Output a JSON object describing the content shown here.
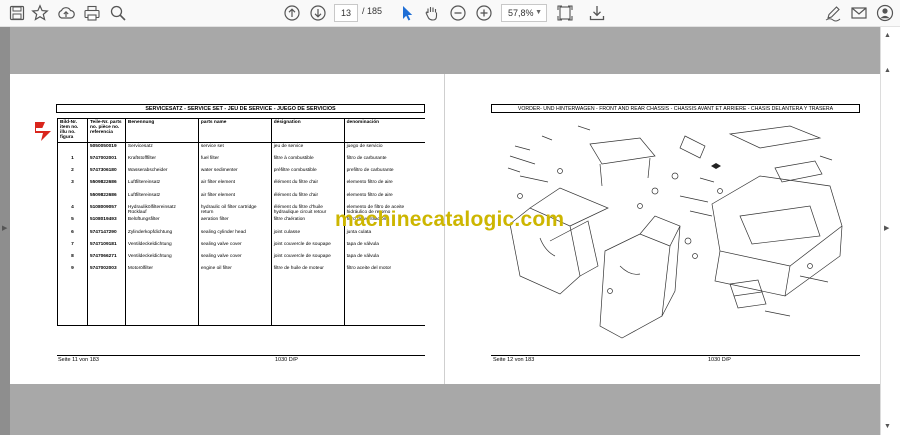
{
  "toolbar": {
    "page_current": "13",
    "page_separator": "/",
    "page_total": "185",
    "zoom": "57,8%",
    "icons": [
      "save-icon",
      "bookmark-star-icon",
      "upload-cloud-icon",
      "print-icon",
      "zoom-search-icon",
      "page-up-icon",
      "page-down-icon",
      "select-cursor-icon",
      "hand-pan-icon",
      "zoom-out-icon",
      "zoom-in-icon",
      "fit-page-icon",
      "download-icon",
      "sign-pen-icon",
      "mail-icon",
      "account-icon"
    ]
  },
  "left_page": {
    "header": "SERVICESATZ - SERVICE SET - JEU DE SERVICE - JUEGO DE SERVICIOS",
    "columns": {
      "bild": "Bild-Nr. item no. illu no. figura",
      "teil": "Teile-Nr. parts no. pièce no. referencia",
      "benennung": "Benennung",
      "parts_name": "parts name",
      "designation": "désignation",
      "denominacion": "denominación"
    },
    "rows": [
      {
        "num": "",
        "code": "5050050019",
        "de": "Servicesatz",
        "en": "service set",
        "fr": "jeu de service",
        "es": "juego de servicio"
      },
      {
        "num": "1",
        "code": "5747002001",
        "de": "Kraftstofffilter",
        "en": "fuel filter",
        "fr": "filtre à combustible",
        "es": "filtro de carburante"
      },
      {
        "num": "2",
        "code": "5747306180",
        "de": "Wasserabscheider",
        "en": "water sedimenter",
        "fr": "préfiltre combustible",
        "es": "prefiltro de carburante"
      },
      {
        "num": "3",
        "code": "5509822686",
        "de": "Luftfiltereinsatz",
        "en": "air filter element",
        "fr": "élément du filtre d'air",
        "es": "elemento filtro de aire"
      },
      {
        "num": "",
        "code": "5509822686",
        "de": "Luftfiltereinsatz",
        "en": "air filter element",
        "fr": "élément du filtre d'air",
        "es": "elemento filtro de aire"
      },
      {
        "num": "4",
        "code": "5108009057",
        "de": "Hydraulikölfiltereinsatz Rücklauf",
        "en": "hydraulic oil filter cartridge return",
        "fr": "élément du filtre d'huile hydraulique circuit retour",
        "es": "elemento de filtro de aceite hidráulico de retorno"
      },
      {
        "num": "5",
        "code": "5108019493",
        "de": "Belüftungsfilter",
        "en": "aeration filter",
        "fr": "filtre d'aération",
        "es": "filtro de ventilación"
      },
      {
        "num": "6",
        "code": "5747147290",
        "de": "Zylinderkopfdichtung",
        "en": "sealing cylinder head",
        "fr": "joint culasse",
        "es": "junta culata"
      },
      {
        "num": "7",
        "code": "5747109181",
        "de": "Ventildeckeldichtung",
        "en": "sealing valve cover",
        "fr": "joint couvercle de soupape",
        "es": "tapa de válvula"
      },
      {
        "num": "8",
        "code": "5747066271",
        "de": "Ventildeckeldichtung",
        "en": "sealing valve cover",
        "fr": "joint couvercle de soupape",
        "es": "tapa de válvula"
      },
      {
        "num": "9",
        "code": "5747002003",
        "de": "Motorölfilter",
        "en": "engine oil filter",
        "fr": "filtre de huile de moteur",
        "es": "filtro aceite del motor"
      }
    ],
    "footer_page": "Seite 11 von 183",
    "footer_model": "1030 D/P"
  },
  "right_page": {
    "header": "VORDER- UND HINTERWAGEN - FRONT AND REAR CHASSIS - CHASSIS AVANT ET ARRIERE - CHASIS DELANTERA Y TRASERA",
    "footer_page": "Seite 12 von 183",
    "footer_model": "1030 D/P"
  },
  "watermark": "machinecatalogic.com",
  "colors": {
    "viewer_bg": "#a8a8a8",
    "watermark": "#cdb600",
    "logo_red": "#d9251c"
  }
}
